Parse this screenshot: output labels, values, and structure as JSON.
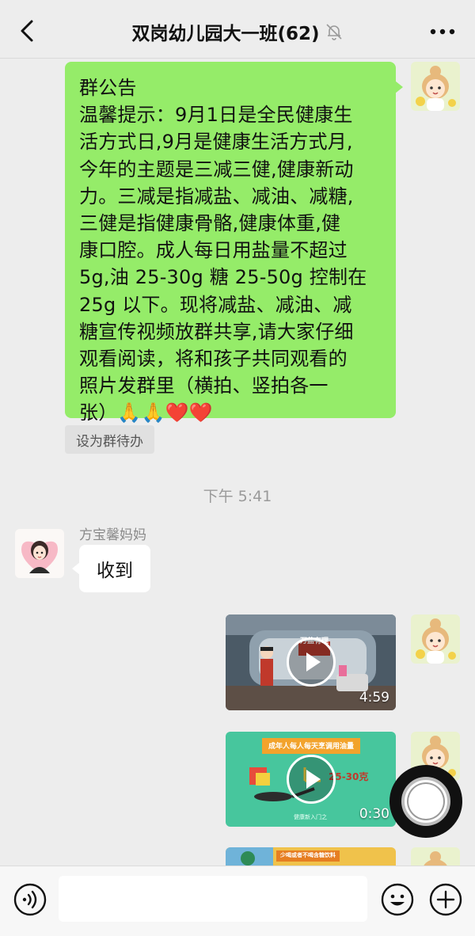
{
  "header": {
    "title": "双岗幼儿园大一班(62)",
    "back_icon": "chevron-left-icon",
    "mute_icon": "bell-off-icon",
    "more_icon": "more-dots-icon"
  },
  "messages": {
    "announcement": {
      "lines": [
        "群公告",
        "温馨提示：9月1日是全民健康生",
        "活方式日,9月是健康生活方式月,",
        "今年的主题是三减三健,健康新动",
        "力。三减是指减盐、减油、减糖,",
        "三健是指健康骨骼,健康体重,健",
        "康口腔。成人每日用盐量不超过",
        "5g,油 25-30g 糖 25-50g 控制在",
        "25g 以下。现将减盐、减油、减",
        "糖宣传视频放群共享,请大家仔细",
        "观看阅读，将和孩子共同观看的",
        "照片发群里（横拍、竖拍各一",
        "张）🙏🙏❤️❤️"
      ]
    },
    "todo_label": "设为群待办",
    "timestamp": "下午 5:41",
    "reply": {
      "sender": "方宝馨妈妈",
      "text": "收到"
    },
    "videos": [
      {
        "duration": "4:59",
        "banner": "万盐有理"
      },
      {
        "duration": "0:30",
        "banner": "成年人每人每天烹调用油量",
        "amount": "25-30克",
        "footer": "健康新入门之"
      },
      {
        "banner": "少喝或者不喝含糖饮料"
      }
    ]
  },
  "input": {
    "placeholder": "",
    "voice_icon": "voice-icon",
    "emoji_icon": "emoji-icon",
    "add_icon": "plus-icon"
  },
  "colors": {
    "background": "#ededed",
    "bubble_self": "#95ec69",
    "bubble_other": "#ffffff"
  }
}
